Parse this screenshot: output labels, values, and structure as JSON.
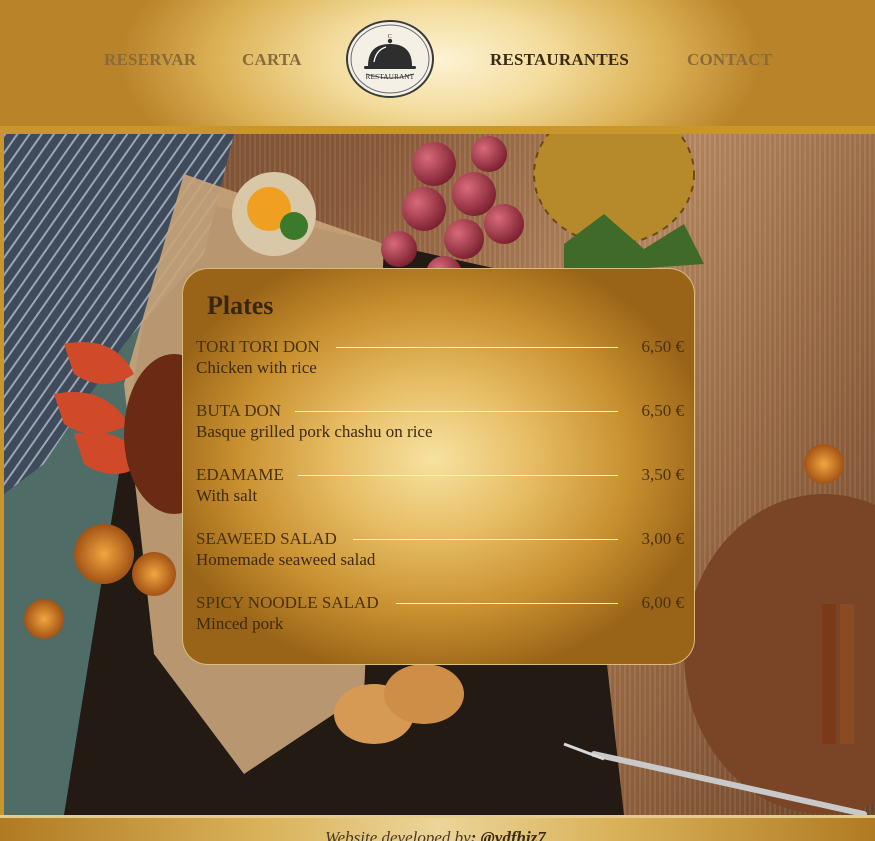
{
  "nav": {
    "reservar": "RESERVAR",
    "carta": "CARTA",
    "restaurantes": "RESTAURANTES",
    "contact": "CONTACT"
  },
  "logo": {
    "text": "RESTAURANT",
    "icon": "cloche-icon"
  },
  "menu": {
    "title": "Plates",
    "items": [
      {
        "name": "TORI TORI DON",
        "description": "Chicken with rice",
        "price": "6,50 €"
      },
      {
        "name": "BUTA DON",
        "description": "Basque grilled pork chashu on rice",
        "price": "6,50 €"
      },
      {
        "name": "EDAMAME",
        "description": "With salt",
        "price": "3,50 €"
      },
      {
        "name": "SEAWEED SALAD",
        "description": "Homemade seaweed salad",
        "price": "3,00 €"
      },
      {
        "name": "SPICY NOODLE SALAD",
        "description": "Minced pork",
        "price": "6,00 €"
      }
    ]
  },
  "footer": {
    "prefix": "Website developed by",
    "handle": ": @ydfhjz7"
  },
  "colors": {
    "gold_light": "#f3dc9c",
    "gold_dark": "#b9832a",
    "text_dark": "#3a2a12",
    "nav_muted": "#8a6a3a"
  }
}
